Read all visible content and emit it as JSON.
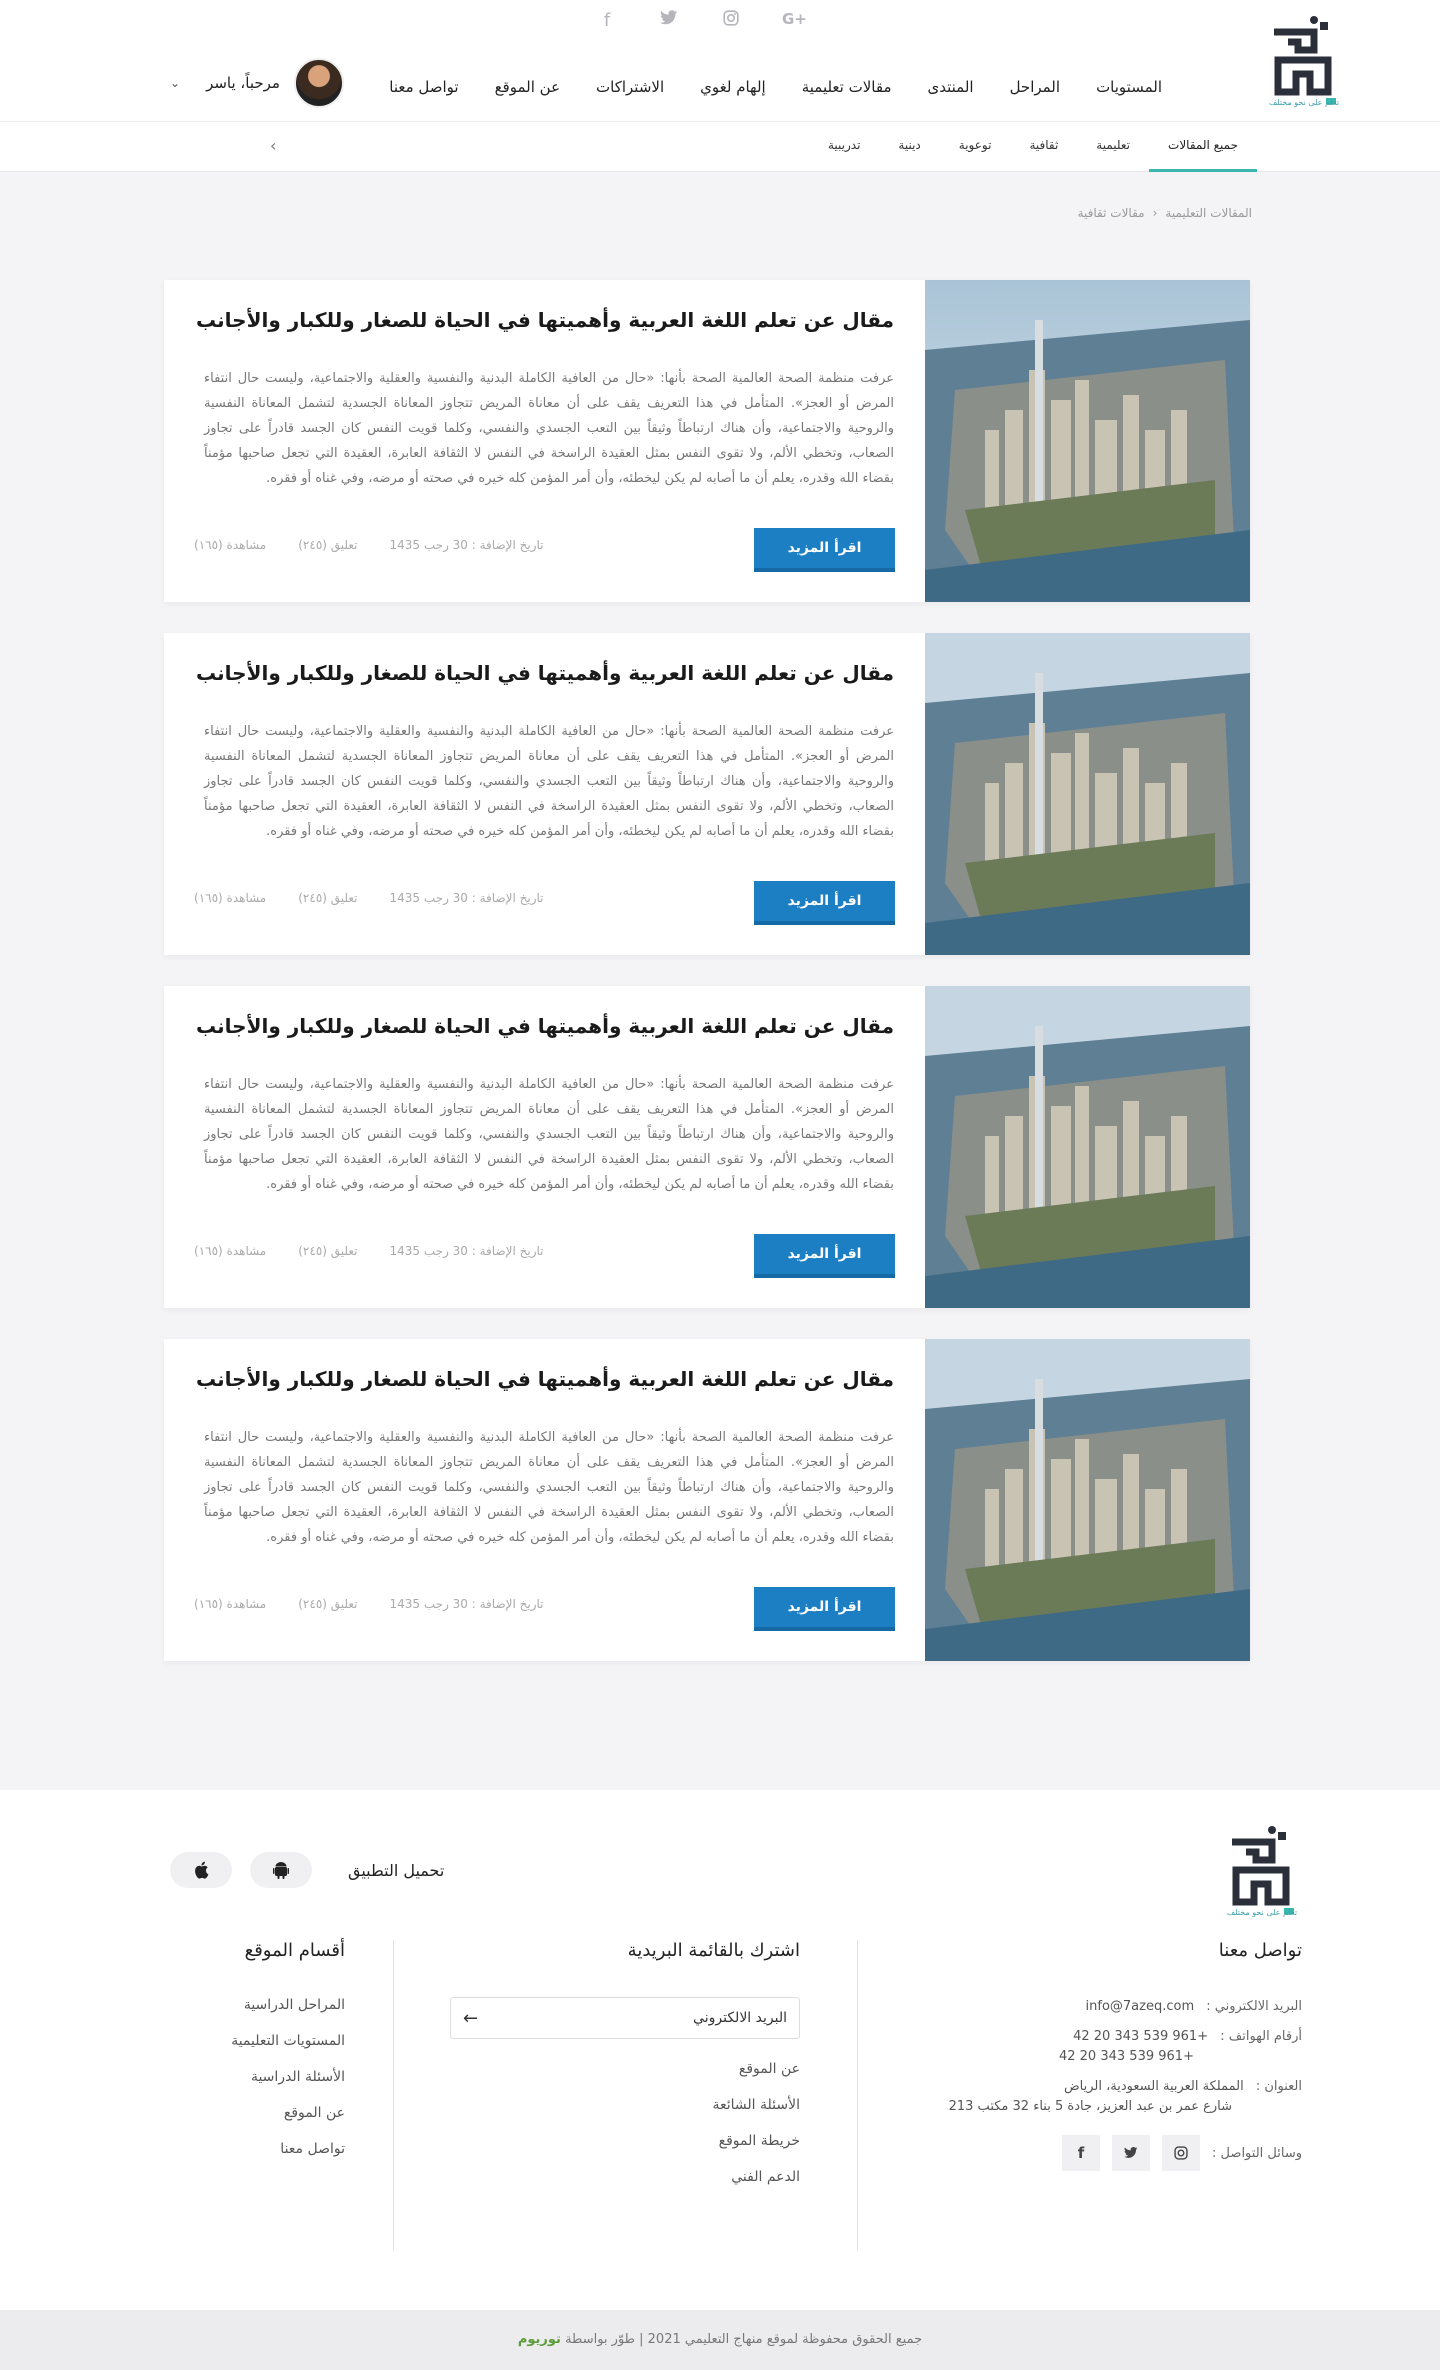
{
  "brand": {
    "tagline": "تعلم على نحو مختلف",
    "colors": {
      "primary": "#1d7fc3",
      "accent": "#3ab8b0",
      "logo": "#2b2f3a"
    }
  },
  "header": {
    "social_icons": [
      "google-plus-icon",
      "instagram-icon",
      "twitter-icon",
      "facebook-icon"
    ],
    "nav": [
      "المستويات",
      "المراحل",
      "المنتدى",
      "مقالات تعليمية",
      "إلهام لغوي",
      "الاشتراكات",
      "عن الموقع",
      "تواصل معنا"
    ],
    "user": {
      "greeting": "مرحباً، ياسر"
    }
  },
  "subnav": {
    "tabs": [
      "جميع المقالات",
      "تعليمية",
      "ثقافية",
      "توعوية",
      "دينية",
      "تدريبية"
    ],
    "active_index": 0
  },
  "breadcrumb": [
    "المقالات التعليمية",
    "مقالات ثقافية"
  ],
  "articles": [
    {
      "title": "مقال عن تعلم اللغة العربية وأهميتها في الحياة للصغار وللكبار والأجانب",
      "excerpt": "عرفت منظمة الصحة العالمية الصحة بأنها: «حال من العافية الكاملة البدنية والنفسية والعقلية والاجتماعية، وليست حال انتفاء المرض أو العجز». المتأمل في هذا التعريف يقف على أن معاناة المريض تتجاوز المعاناة الجسدية لتشمل المعاناة النفسية والروحية والاجتماعية، وأن هناك ارتباطاً وثيقاً بين التعب الجسدي والنفسي، وكلما قويت النفس كان الجسد قادراً على تجاوز الصعاب، وتخطي الألم، ولا تقوى النفس بمثل العقيدة الراسخة في النفس لا الثقافة العابرة، العقيدة التي تجعل صاحبها مؤمناً بقضاء الله وقدره، يعلم أن ما أصابه لم يكن ليخطئه، وأن أمر المؤمن كله خيره في صحته أو مرضه، وفي غناه أو فقره.",
      "button": "اقرأ المزيد",
      "views": "مشاهدة (١٦٥)",
      "comments": "تعليق (٢٤٥)",
      "date": "تاريخ الإضافة : 30 رجب 1435"
    },
    {
      "title": "مقال عن تعلم اللغة العربية وأهميتها في الحياة للصغار وللكبار والأجانب",
      "excerpt": "عرفت منظمة الصحة العالمية الصحة بأنها: «حال من العافية الكاملة البدنية والنفسية والعقلية والاجتماعية، وليست حال انتفاء المرض أو العجز». المتأمل في هذا التعريف يقف على أن معاناة المريض تتجاوز المعاناة الجسدية لتشمل المعاناة النفسية والروحية والاجتماعية، وأن هناك ارتباطاً وثيقاً بين التعب الجسدي والنفسي، وكلما قويت النفس كان الجسد قادراً على تجاوز الصعاب، وتخطي الألم، ولا تقوى النفس بمثل العقيدة الراسخة في النفس لا الثقافة العابرة، العقيدة التي تجعل صاحبها مؤمناً بقضاء الله وقدره، يعلم أن ما أصابه لم يكن ليخطئه، وأن أمر المؤمن كله خيره في صحته أو مرضه، وفي غناه أو فقره.",
      "button": "اقرأ المزيد",
      "views": "مشاهدة (١٦٥)",
      "comments": "تعليق (٢٤٥)",
      "date": "تاريخ الإضافة : 30 رجب 1435"
    },
    {
      "title": "مقال عن تعلم اللغة العربية وأهميتها في الحياة للصغار وللكبار والأجانب",
      "excerpt": "عرفت منظمة الصحة العالمية الصحة بأنها: «حال من العافية الكاملة البدنية والنفسية والعقلية والاجتماعية، وليست حال انتفاء المرض أو العجز». المتأمل في هذا التعريف يقف على أن معاناة المريض تتجاوز المعاناة الجسدية لتشمل المعاناة النفسية والروحية والاجتماعية، وأن هناك ارتباطاً وثيقاً بين التعب الجسدي والنفسي، وكلما قويت النفس كان الجسد قادراً على تجاوز الصعاب، وتخطي الألم، ولا تقوى النفس بمثل العقيدة الراسخة في النفس لا الثقافة العابرة، العقيدة التي تجعل صاحبها مؤمناً بقضاء الله وقدره، يعلم أن ما أصابه لم يكن ليخطئه، وأن أمر المؤمن كله خيره في صحته أو مرضه، وفي غناه أو فقره.",
      "button": "اقرأ المزيد",
      "views": "مشاهدة (١٦٥)",
      "comments": "تعليق (٢٤٥)",
      "date": "تاريخ الإضافة : 30 رجب 1435"
    },
    {
      "title": "مقال عن تعلم اللغة العربية وأهميتها في الحياة للصغار وللكبار والأجانب",
      "excerpt": "عرفت منظمة الصحة العالمية الصحة بأنها: «حال من العافية الكاملة البدنية والنفسية والعقلية والاجتماعية، وليست حال انتفاء المرض أو العجز». المتأمل في هذا التعريف يقف على أن معاناة المريض تتجاوز المعاناة الجسدية لتشمل المعاناة النفسية والروحية والاجتماعية، وأن هناك ارتباطاً وثيقاً بين التعب الجسدي والنفسي، وكلما قويت النفس كان الجسد قادراً على تجاوز الصعاب، وتخطي الألم، ولا تقوى النفس بمثل العقيدة الراسخة في النفس لا الثقافة العابرة، العقيدة التي تجعل صاحبها مؤمناً بقضاء الله وقدره، يعلم أن ما أصابه لم يكن ليخطئه، وأن أمر المؤمن كله خيره في صحته أو مرضه، وفي غناه أو فقره.",
      "button": "اقرأ المزيد",
      "views": "مشاهدة (١٦٥)",
      "comments": "تعليق (٢٤٥)",
      "date": "تاريخ الإضافة : 30 رجب 1435"
    }
  ],
  "footer": {
    "app_download": {
      "label": "تحميل التطبيق",
      "icons": [
        "android-icon",
        "apple-icon"
      ]
    },
    "contact": {
      "title": "تواصل معنا",
      "email_label": "البريد الالكتروني :",
      "email": "info@7azeq.com",
      "phones_label": "أرقام الهواتف :",
      "phone1": "+961 539 343 20 42",
      "phone2": "+961 539 343 20 42",
      "address_label": "العنوان :",
      "address1": "المملكة العربية السعودية، الرياض",
      "address2": "شارع عمر بن عبد العزيز، جادة 5 بناء 32 مكتب 213",
      "social_label": "وسائل التواصل :",
      "social_icons": [
        "instagram-icon",
        "twitter-icon",
        "facebook-icon"
      ]
    },
    "newsletter": {
      "title": "اشترك بالقائمة البريدية",
      "placeholder": "البريد الالكتروني",
      "links": [
        "عن الموقع",
        "الأسئلة الشائعة",
        "خريطة الموقع",
        "الدعم الفني"
      ]
    },
    "sections": {
      "title": "أقسام الموقع",
      "links": [
        "المراحل الدراسية",
        "المستويات التعليمية",
        "الأسئلة الدراسية",
        "عن الموقع",
        "تواصل معنا"
      ]
    },
    "copyright": {
      "text": "جميع الحقوق محفوظة لموقع منهاج التعليمي 2021 | طوّر بواسطة",
      "brand": "توريوم"
    }
  }
}
